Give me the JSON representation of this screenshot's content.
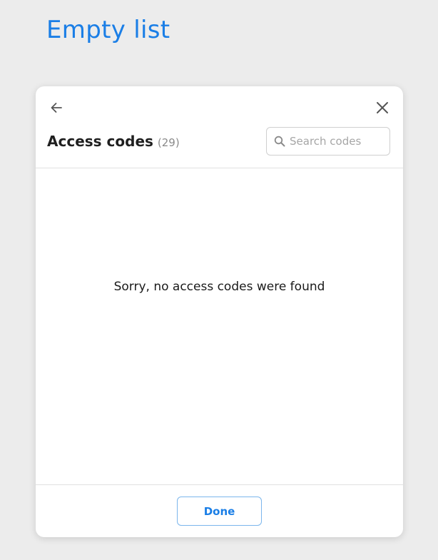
{
  "page": {
    "heading": "Empty list"
  },
  "modal": {
    "title": "Access codes",
    "count": "(29)",
    "search": {
      "placeholder": "Search codes",
      "value": ""
    },
    "empty_message": "Sorry, no access codes were found",
    "done_label": "Done",
    "icons": {
      "back": "arrow-left-icon",
      "close": "close-icon",
      "search": "search-icon"
    }
  },
  "colors": {
    "accent": "#1a7ee6",
    "background": "#ececec",
    "panel": "#ffffff"
  }
}
